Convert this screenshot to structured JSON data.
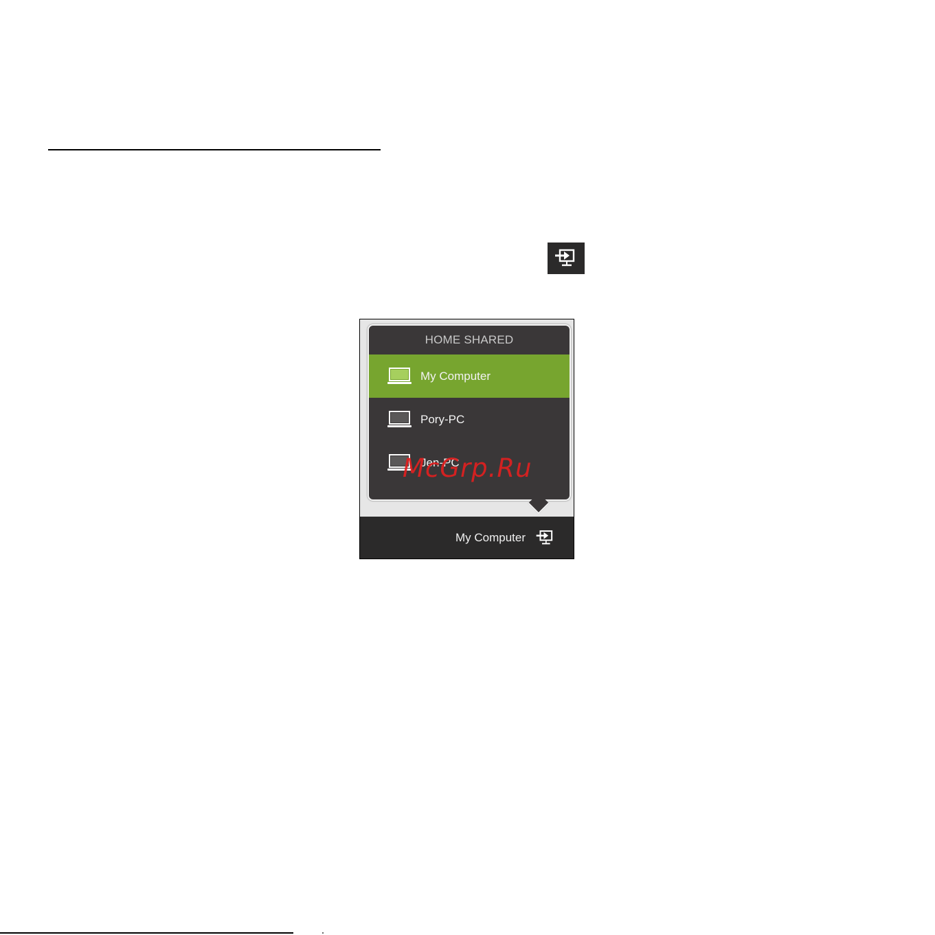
{
  "popup": {
    "header": "HOME SHARED",
    "devices": [
      {
        "label": "My Computer",
        "icon": "laptop-icon",
        "selected": true
      },
      {
        "label": "Pory-PC",
        "icon": "laptop-icon",
        "selected": false
      },
      {
        "label": "Jen-PC",
        "icon": "laptop-icon",
        "selected": false
      }
    ]
  },
  "bottom_bar": {
    "label": "My Computer",
    "icon": "display-switch-icon"
  },
  "watermark": "McGrp.Ru",
  "colors": {
    "selected_row": "#77a52f",
    "popup_background": "#3a3738",
    "bar_background": "#2b2a2a",
    "watermark": "#e02020"
  }
}
